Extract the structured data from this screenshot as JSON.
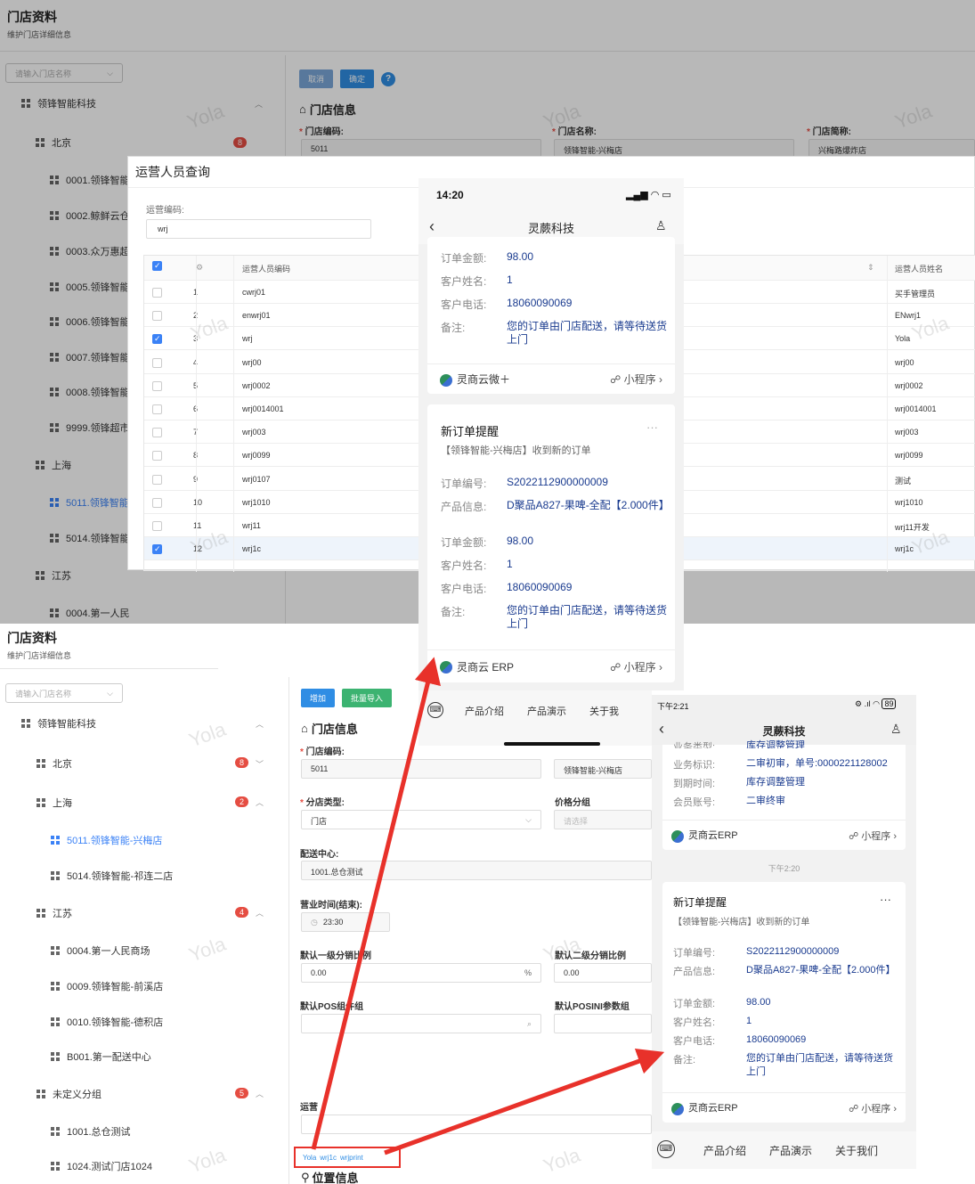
{
  "top_page": {
    "title": "门店资料",
    "subtitle": "维护门店详细信息",
    "search_placeholder": "请输入门店名称",
    "buttons": {
      "cancel": "取消",
      "confirm": "确定",
      "help": "?"
    },
    "section_title": "门店信息",
    "fields": [
      {
        "label": "门店编码:",
        "value": "5011"
      },
      {
        "label": "门店名称:",
        "value": "领锋智能-兴梅店"
      },
      {
        "label": "门店简称:",
        "value": "兴梅路爆炸店"
      }
    ],
    "tree": [
      {
        "label": "领锋智能科技"
      },
      {
        "label": "北京",
        "badge": "8"
      },
      {
        "label": "0001.领锋智能"
      },
      {
        "label": "0002.鲸鲜云仓"
      },
      {
        "label": "0003.众万惠超"
      },
      {
        "label": "0005.领锋智能"
      },
      {
        "label": "0006.领锋智能"
      },
      {
        "label": "0007.领锋智能"
      },
      {
        "label": "0008.领锋智能"
      },
      {
        "label": "9999.领锋超市"
      },
      {
        "label": "上海"
      },
      {
        "label": "5011.领锋智能"
      },
      {
        "label": "5014.领锋智能"
      },
      {
        "label": "江苏"
      },
      {
        "label": "0004.第一人民"
      }
    ]
  },
  "dialog": {
    "title": "运营人员查询",
    "code_label": "运营编码:",
    "code_value": "wrj",
    "columns": {
      "code": "运营人员编码",
      "name": "运营人员姓名"
    },
    "rows": [
      {
        "no": "1",
        "code": "cwrj01",
        "name": "买手管理员",
        "checked": false
      },
      {
        "no": "2",
        "code": "enwrj01",
        "name": "ENwrj1",
        "checked": false
      },
      {
        "no": "3",
        "code": "wrj",
        "name": "Yola",
        "checked": true
      },
      {
        "no": "4",
        "code": "wrj00",
        "name": "wrj00",
        "checked": false
      },
      {
        "no": "5",
        "code": "wrj0002",
        "name": "wrj0002",
        "checked": false
      },
      {
        "no": "6",
        "code": "wrj0014001",
        "name": "wrj0014001",
        "checked": false
      },
      {
        "no": "7",
        "code": "wrj003",
        "name": "wrj003",
        "checked": false
      },
      {
        "no": "8",
        "code": "wrj0099",
        "name": "wrj0099",
        "checked": false
      },
      {
        "no": "9",
        "code": "wrj0107",
        "name": "测试",
        "checked": false
      },
      {
        "no": "10",
        "code": "wrj1010",
        "name": "wrj1010",
        "checked": false
      },
      {
        "no": "11",
        "code": "wrj11",
        "name": "wrj11开发",
        "checked": false
      },
      {
        "no": "12",
        "code": "wrj1c",
        "name": "wrj1c",
        "checked": true
      }
    ]
  },
  "phone1": {
    "time": "14:20",
    "title": "灵蕨科技",
    "card1": {
      "rows": [
        {
          "k": "订单金额:",
          "v": "98.00"
        },
        {
          "k": "客户姓名:",
          "v": "1"
        },
        {
          "k": "客户电话:",
          "v": "18060090069"
        },
        {
          "k": "备注:",
          "v": "您的订单由门店配送，请等待送货上门"
        }
      ],
      "app": "灵商云微＋",
      "mini": "小程序"
    },
    "card2": {
      "title": "新订单提醒",
      "subtitle": "【领锋智能-兴梅店】收到新的订单",
      "more": "···",
      "rows": [
        {
          "k": "订单编号:",
          "v": "S2022112900000009"
        },
        {
          "k": "产品信息:",
          "v": "D聚品A827-果啤-全配【2.000件】"
        },
        {
          "k": "订单金额:",
          "v": "98.00"
        },
        {
          "k": "客户姓名:",
          "v": "1"
        },
        {
          "k": "客户电话:",
          "v": "18060090069"
        },
        {
          "k": "备注:",
          "v": "您的订单由门店配送，请等待送货上门"
        }
      ],
      "app": "灵商云 ERP",
      "mini": "小程序"
    },
    "tabs": [
      "产品介绍",
      "产品演示",
      "关于我"
    ]
  },
  "bottom_page": {
    "title": "门店资料",
    "subtitle": "维护门店详细信息",
    "search_placeholder": "请输入门店名称",
    "buttons": {
      "add": "增加",
      "import": "批量导入"
    },
    "section_title": "门店信息",
    "location_title": "位置信息",
    "fields": {
      "code_label": "门店编码:",
      "code_value": "5011",
      "name_value": "领锋智能-兴梅店",
      "type_label": "分店类型:",
      "type_value": "门店",
      "price_label": "价格分组",
      "price_placeholder": "请选择",
      "dc_label": "配送中心:",
      "dc_value": "1001.总仓测试",
      "hours_label": "营业时间(结束):",
      "hours_value": "23:30",
      "ratio1_label": "默认一级分销比例",
      "ratio1_value": "0.00",
      "percent": "%",
      "ratio2_label": "默认二级分销比例",
      "ratio2_value": "0.00",
      "pos_label": "默认POS组件组",
      "posini_label": "默认POSINI参数组",
      "ops_label": "运营",
      "ops_tags": [
        "Yola",
        "wrj1c",
        "wrjprint"
      ]
    },
    "tree": [
      {
        "label": "领锋智能科技"
      },
      {
        "label": "北京",
        "badge": "8"
      },
      {
        "label": "上海",
        "badge": "2"
      },
      {
        "label": "5011.领锋智能-兴梅店"
      },
      {
        "label": "5014.领锋智能-祁连二店"
      },
      {
        "label": "江苏",
        "badge": "4"
      },
      {
        "label": "0004.第一人民商场"
      },
      {
        "label": "0009.领锋智能-前溪店"
      },
      {
        "label": "0010.领锋智能-德积店"
      },
      {
        "label": "B001.第一配送中心"
      },
      {
        "label": "未定义分组",
        "badge": "5"
      },
      {
        "label": "1001.总仓测试"
      },
      {
        "label": "1024.测试门店1024"
      }
    ]
  },
  "phone2": {
    "time": "下午2:21",
    "battery": "89",
    "title": "灵蕨科技",
    "card1": {
      "rows": [
        {
          "k": "业务类型:",
          "v": "库存调整管理"
        },
        {
          "k": "业务标识:",
          "v": "二审初审，单号:0000221128002"
        },
        {
          "k": "到期时间:",
          "v": "库存调整管理"
        },
        {
          "k": "会员账号:",
          "v": "二审终审"
        }
      ],
      "app": "灵商云ERP",
      "mini": "小程序"
    },
    "timestamp": "下午2:20",
    "card2": {
      "title": "新订单提醒",
      "subtitle": "【领锋智能-兴梅店】收到新的订单",
      "more": "···",
      "rows": [
        {
          "k": "订单编号:",
          "v": "S2022112900000009"
        },
        {
          "k": "产品信息:",
          "v": "D聚品A827-果啤-全配【2.000件】"
        },
        {
          "k": "订单金额:",
          "v": "98.00"
        },
        {
          "k": "客户姓名:",
          "v": "1"
        },
        {
          "k": "客户电话:",
          "v": "18060090069"
        },
        {
          "k": "备注:",
          "v": "您的订单由门店配送，请等待送货上门"
        }
      ],
      "app": "灵商云ERP",
      "mini": "小程序"
    },
    "tabs": [
      "产品介绍",
      "产品演示",
      "关于我们"
    ]
  },
  "watermark": "Yola",
  "colors": {
    "accent": "#2f8de4",
    "arrow": "#e8312a",
    "badge": "#e54d42",
    "link": "#1a3b8f"
  }
}
